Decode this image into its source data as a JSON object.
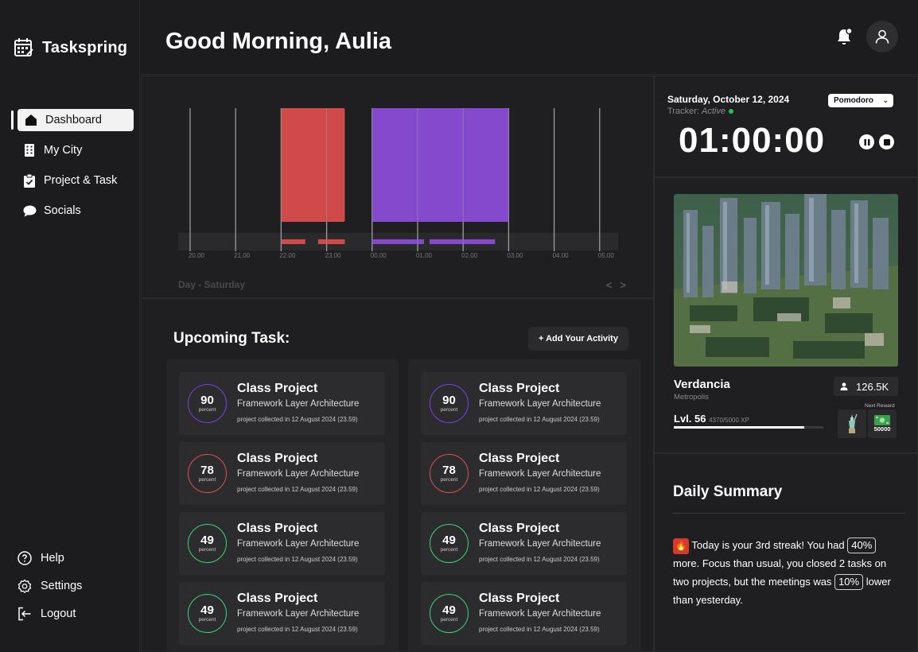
{
  "app": {
    "name": "Taskspring"
  },
  "sidebar": {
    "items": [
      {
        "label": "Dashboard",
        "icon": "home-icon",
        "active": true
      },
      {
        "label": "My City",
        "icon": "building-icon"
      },
      {
        "label": "Project & Task",
        "icon": "clipboard-icon"
      },
      {
        "label": "Socials",
        "icon": "chat-icon"
      }
    ],
    "bottom": [
      {
        "label": "Help",
        "icon": "help-icon"
      },
      {
        "label": "Settings",
        "icon": "gear-icon"
      },
      {
        "label": "Logout",
        "icon": "logout-icon"
      }
    ]
  },
  "header": {
    "greeting": "Good Morning, Aulia"
  },
  "chart_data": {
    "type": "bar",
    "categories": [
      "20.00",
      "21.00",
      "22.00",
      "23.00",
      "00.00",
      "01.00",
      "02.00",
      "03.00",
      "04.00",
      "05.00"
    ],
    "series": [
      {
        "color": "#cf4a48",
        "start": 22.0,
        "end": 23.4
      },
      {
        "color": "#8449cc",
        "start": 24.0,
        "end": 27.0
      }
    ],
    "xlabel": "Day - Saturday"
  },
  "tracker": {
    "date": "Saturday, October 12, 2024",
    "status_label": "Tracker:",
    "status_value": "Active",
    "mode": "Pomodoro",
    "time": "01:00:00",
    "colors": {
      "active": "#27c25c"
    }
  },
  "city": {
    "name": "Verdancia",
    "type": "Metropolis",
    "population": "126.5K",
    "level": "Lvl. 56",
    "xp": "4370/5000 XP",
    "xp_progress": 0.874,
    "next_reward_label": "Next Reward",
    "rewards": [
      {
        "icon": "statue-icon",
        "label": ""
      },
      {
        "icon": "money-icon",
        "label": "50000"
      }
    ]
  },
  "summary": {
    "title": "Daily Summary",
    "text_1": "Today is your 3rd streak! You had",
    "pill_1": "40%",
    "text_2": "more. Focus than usual, you closed 2 tasks on two projects, but the meetings was",
    "pill_2": "10%",
    "text_3": "lower than yesterday."
  },
  "tasks": {
    "title": "Upcoming Task:",
    "add_label": "+ Add Your Activity",
    "columns": [
      [
        {
          "percent": "90",
          "unit": "percent",
          "title": "Class Project",
          "subtitle": "Framework Layer Architecture",
          "meta": "project collected in 12 August 2024 (23.59)",
          "color": "#7b3fe4"
        },
        {
          "percent": "78",
          "unit": "percent",
          "title": "Class Project",
          "subtitle": "Framework Layer Architecture",
          "meta": "project collected in 12 August 2024 (23.59)",
          "color": "#d9524f"
        },
        {
          "percent": "49",
          "unit": "percent",
          "title": "Class Project",
          "subtitle": "Framework Layer Architecture",
          "meta": "project collected in 12 August 2024 (23.59)",
          "color": "#3ad37a"
        },
        {
          "percent": "49",
          "unit": "percent",
          "title": "Class Project",
          "subtitle": "Framework Layer Architecture",
          "meta": "project collected in 12 August 2024 (23.59)",
          "color": "#3ad37a"
        }
      ],
      [
        {
          "percent": "90",
          "unit": "percent",
          "title": "Class Project",
          "subtitle": "Framework Layer Architecture",
          "meta": "project collected in 12 August 2024 (23.59)",
          "color": "#7b3fe4"
        },
        {
          "percent": "78",
          "unit": "percent",
          "title": "Class Project",
          "subtitle": "Framework Layer Architecture",
          "meta": "project collected in 12 August 2024 (23.59)",
          "color": "#d9524f"
        },
        {
          "percent": "49",
          "unit": "percent",
          "title": "Class Project",
          "subtitle": "Framework Layer Architecture",
          "meta": "project collected in 12 August 2024 (23.59)",
          "color": "#3ad37a"
        },
        {
          "percent": "49",
          "unit": "percent",
          "title": "Class Project",
          "subtitle": "Framework Layer Architecture",
          "meta": "project collected in 12 August 2024 (23.59)",
          "color": "#3ad37a"
        }
      ]
    ]
  }
}
